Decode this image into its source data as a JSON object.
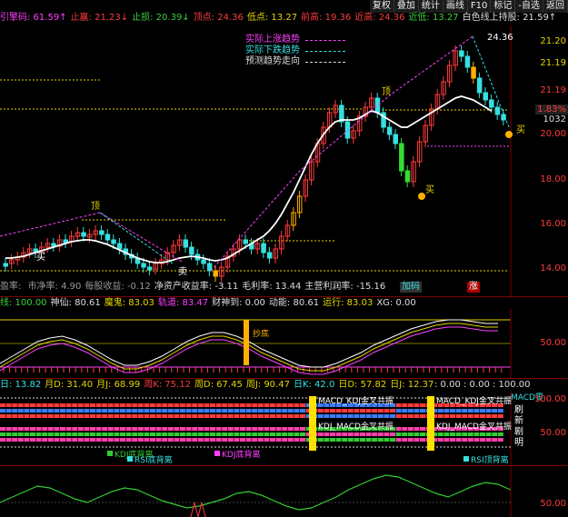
{
  "toolbar": {
    "buttons": [
      "复权",
      "叠加",
      "统计",
      "画线",
      "F10",
      "标记",
      "-自选",
      "返回"
    ]
  },
  "info_bar": {
    "items": [
      {
        "label": "引擎码",
        "value": "61.59",
        "arrow": "↑"
      },
      {
        "label": "止赢",
        "value": "21.23",
        "arrow": "↓"
      },
      {
        "label": "止损",
        "value": "20.39",
        "arrow": "↓"
      },
      {
        "label": "顶点",
        "value": "24.36"
      },
      {
        "label": "低点",
        "value": "13.27"
      },
      {
        "label": "前高",
        "value": "19.36"
      },
      {
        "label": "近高",
        "value": "24.36"
      },
      {
        "label": "近低",
        "value": "13.27"
      },
      {
        "label": "白色线上持股",
        "value": "21.59",
        "arrow": "↑"
      }
    ]
  },
  "legend": [
    {
      "label": "实际上涨趋势",
      "color": "#ff40ff"
    },
    {
      "label": "实际下跌趋势",
      "color": "#35e0e0"
    },
    {
      "label": "预测趋势走向",
      "color": "#dddddd"
    }
  ],
  "price_axis": [
    "21.20",
    "21.19",
    "21.19",
    "20.00",
    "18.00",
    "16.00",
    "14.00"
  ],
  "price_tags": {
    "current": "21.19",
    "change": "1.83%",
    "volume": "1032",
    "peak": "24.36"
  },
  "chart_labels": {
    "ding": "顶",
    "buy": "买",
    "sell": "卖",
    "peak": "24.36"
  },
  "fundamentals": {
    "items": [
      {
        "label": "盈率",
        "value": ""
      },
      {
        "label": "市净率",
        "value": "4.90"
      },
      {
        "label": "每股收益",
        "value": "-0.12"
      },
      {
        "label": "净资产收益率",
        "value": "-3.11"
      },
      {
        "label": "毛利率",
        "value": "13.44"
      },
      {
        "label": "主营利润率",
        "value": "-15.16"
      }
    ],
    "badge1": "加码",
    "badge2": "涨"
  },
  "indicator1_bar": {
    "items": [
      {
        "label": "线",
        "value": "100.00",
        "color": "#3bd13b"
      },
      {
        "label": "神仙",
        "value": "80.61",
        "color": "#dddddd"
      },
      {
        "label": "魔鬼",
        "value": "83.03",
        "color": "#e6d400"
      },
      {
        "label": "轨道",
        "value": "83.47",
        "color": "#ff40ff"
      },
      {
        "label": "财神到",
        "value": "0.00",
        "color": "#dddddd"
      },
      {
        "label": "动能",
        "value": "80.61",
        "color": "#dddddd"
      },
      {
        "label": "运行",
        "value": "83.03",
        "color": "#e6d400"
      },
      {
        "label": "XG",
        "value": "0.00",
        "color": "#dddddd"
      }
    ],
    "axis": [
      "50.00"
    ],
    "marker": "抄底"
  },
  "indicator2_bar": {
    "items": [
      {
        "label": "日",
        "value": "13.82",
        "color": "#35e0e0"
      },
      {
        "label": "月D",
        "value": "31.40",
        "color": "#e6d400"
      },
      {
        "label": "月J",
        "value": "68.99",
        "color": "#e6d400"
      },
      {
        "label": "周K",
        "value": "75.12",
        "color": "#ff3b3b"
      },
      {
        "label": "周D",
        "value": "67.45",
        "color": "#e6d400"
      },
      {
        "label": "周J",
        "value": "90.47",
        "color": "#e6d400"
      },
      {
        "label": "日K",
        "value": "42.0",
        "color": "#35e0e0"
      },
      {
        "label": "日D",
        "value": "57.82",
        "color": "#e6d400"
      },
      {
        "label": "日J",
        "value": "12.37",
        "color": "#e6d400"
      }
    ],
    "right_values": [
      "0.00",
      "0.00",
      "100.00"
    ],
    "axis": [
      "100.00",
      "50.00"
    ],
    "tags": [
      "MACD_KDJ金叉共振",
      "MACD_KDJ金叉共振",
      "KDJ_MACD金叉共振",
      "KDJ_MACD金叉共振",
      "MACD零"
    ],
    "side": [
      "刷",
      "新",
      "剧",
      "明"
    ],
    "bottom_tags": [
      "KDJ底背离",
      "RSI底背离",
      "KDJ底背离",
      "RSI顶背离"
    ]
  },
  "indicator3": {
    "axis": [
      "50.00"
    ]
  }
}
